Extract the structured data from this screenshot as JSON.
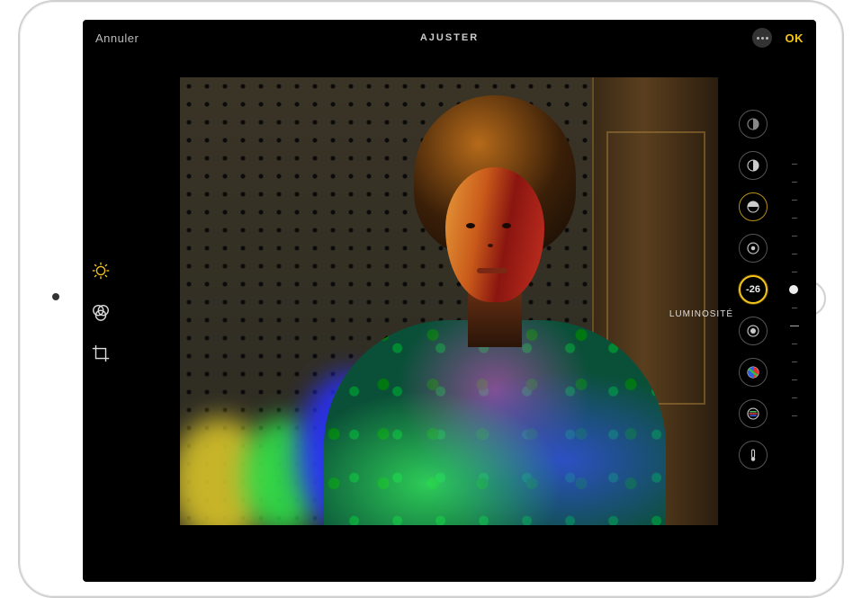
{
  "header": {
    "cancel": "Annuler",
    "title": "AJUSTER",
    "ok": "OK"
  },
  "leftTools": [
    {
      "name": "adjust-icon",
      "active": true
    },
    {
      "name": "filters-icon",
      "active": false
    },
    {
      "name": "crop-icon",
      "active": false
    }
  ],
  "adjustments": [
    {
      "name": "auto-icon",
      "label": "Auto"
    },
    {
      "name": "exposure-icon",
      "label": "Exposition"
    },
    {
      "name": "brilliance-icon",
      "label": "Brillance"
    },
    {
      "name": "highlights-icon",
      "label": "Tons clairs"
    },
    {
      "name": "brightness-icon",
      "label": "LUMINOSITÉ",
      "selected": true,
      "value": "-26"
    },
    {
      "name": "blackpoint-icon",
      "label": "Point noir"
    },
    {
      "name": "saturation-icon",
      "label": "Saturation"
    },
    {
      "name": "vibrance-icon",
      "label": "Vibrance"
    },
    {
      "name": "warmth-icon",
      "label": "Chaleur"
    }
  ],
  "selectedLabel": "LUMINOSITÉ",
  "selectedValue": "-26",
  "colors": {
    "accent": "#f5c518"
  }
}
